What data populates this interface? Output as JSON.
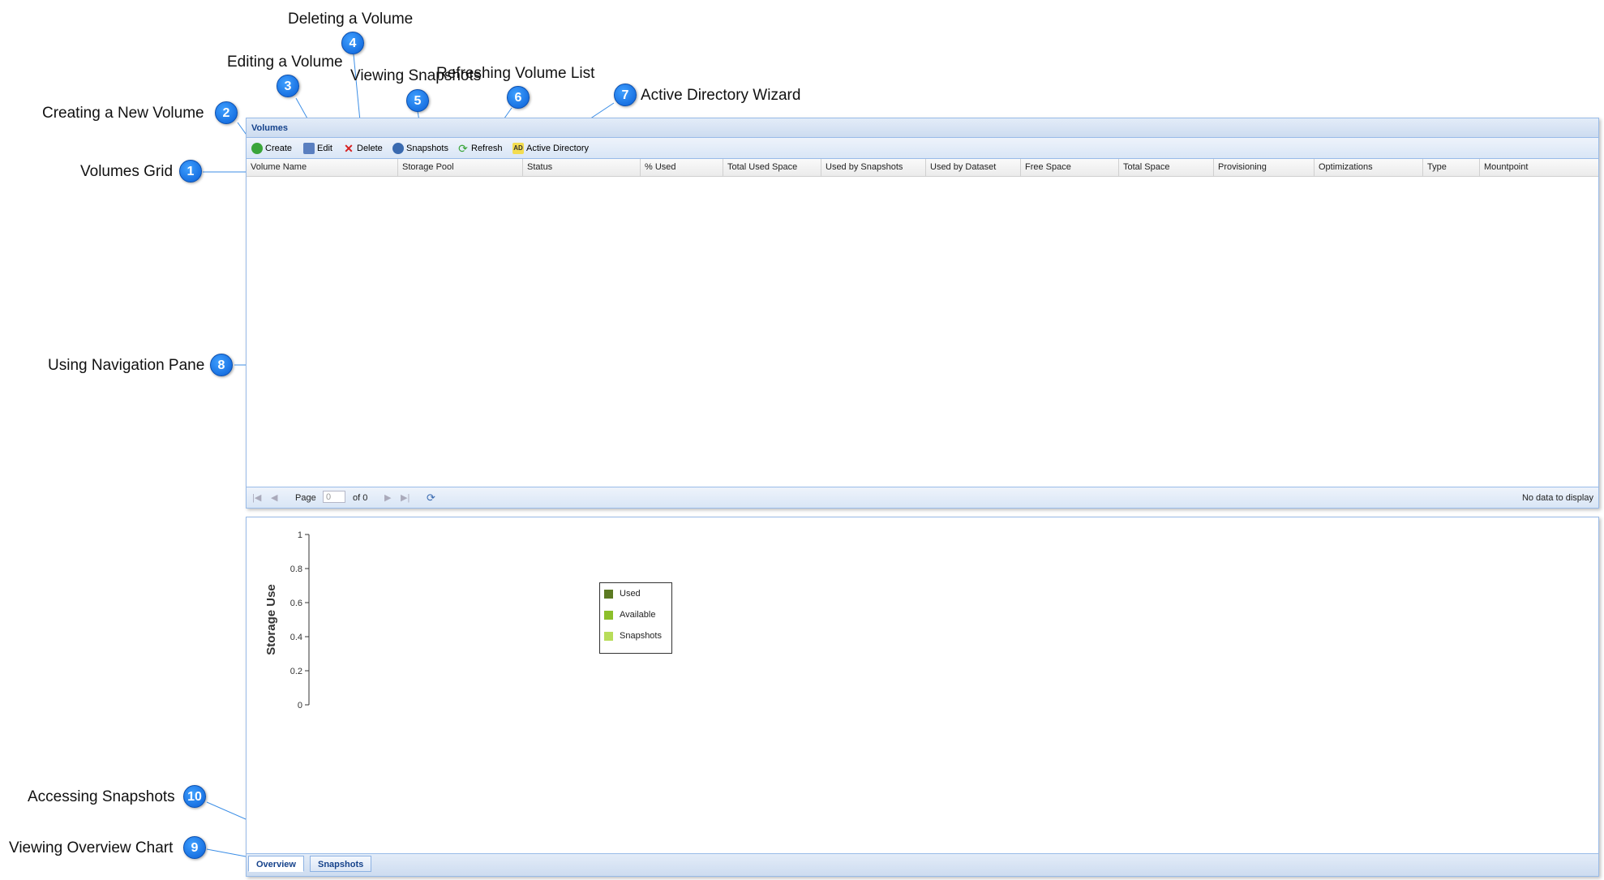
{
  "panel": {
    "title": "Volumes",
    "toolbar": [
      {
        "label": "Create",
        "icon": "add-icon",
        "color": "#3aa53a"
      },
      {
        "label": "Edit",
        "icon": "edit-icon",
        "color": "#5a7fc0"
      },
      {
        "label": "Delete",
        "icon": "delete-icon",
        "color": "#d62020"
      },
      {
        "label": "Snapshots",
        "icon": "snapshots-icon",
        "color": "#3a6ab0"
      },
      {
        "label": "Refresh",
        "icon": "refresh-icon",
        "color": "#3aa53a"
      },
      {
        "label": "Active Directory",
        "icon": "active-directory-icon",
        "color": "#e0c020",
        "glyph": "AD"
      }
    ],
    "columns": [
      "Volume Name",
      "Storage Pool",
      "Status",
      "% Used",
      "Total Used Space",
      "Used by Snapshots",
      "Used by Dataset",
      "Free Space",
      "Total Space",
      "Provisioning",
      "Optimizations",
      "Type",
      "Mountpoint"
    ],
    "paging": {
      "page_label": "Page",
      "page_value": "0",
      "of_label": "of 0",
      "status": "No data to display"
    }
  },
  "chart_data": {
    "type": "bar",
    "title": "",
    "ylabel": "Storage Use",
    "ylim": [
      0,
      1
    ],
    "yticks": [
      "0",
      "0.2",
      "0.4",
      "0.6",
      "0.8",
      "1"
    ],
    "categories": [],
    "series": [
      {
        "name": "Used",
        "values": [],
        "color": "#5c7a22"
      },
      {
        "name": "Available",
        "values": [],
        "color": "#8cbf2a"
      },
      {
        "name": "Snapshots",
        "values": [],
        "color": "#b8dd5a"
      }
    ],
    "legend": "middle-left"
  },
  "tabs": [
    {
      "label": "Overview",
      "active": true
    },
    {
      "label": "Snapshots",
      "active": false
    }
  ],
  "annotations": [
    {
      "number": "1",
      "text": "Volumes Grid"
    },
    {
      "number": "2",
      "text": "Creating a New Volume"
    },
    {
      "number": "3",
      "text": "Editing a Volume"
    },
    {
      "number": "4",
      "text": "Deleting a Volume"
    },
    {
      "number": "5",
      "text": "Viewing Snapshots"
    },
    {
      "number": "6",
      "text": "Refreshing Volume List"
    },
    {
      "number": "7",
      "text": "Active Directory Wizard"
    },
    {
      "number": "8",
      "text": "Using Navigation Pane"
    },
    {
      "number": "9",
      "text": "Viewing Overview Chart"
    },
    {
      "number": "10",
      "text": "Accessing Snapshots"
    }
  ]
}
